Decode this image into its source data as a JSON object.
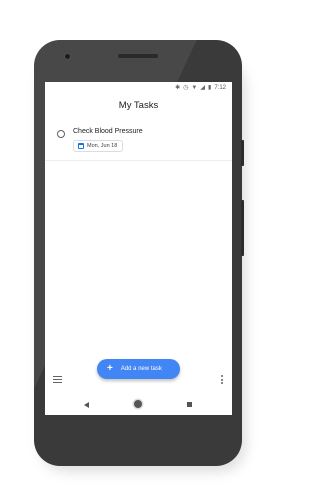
{
  "status_bar": {
    "time": "7:12",
    "icons": [
      "bluetooth-icon",
      "alarm-icon",
      "wifi-icon",
      "signal-icon",
      "battery-icon"
    ]
  },
  "app": {
    "title": "My Tasks"
  },
  "tasks": [
    {
      "title": "Check Blood Pressure",
      "due_date": "Mon, Jun 18",
      "completed": false
    }
  ],
  "fab": {
    "label": "Add a new task",
    "icon": "plus-icon"
  },
  "bottom_bar": {
    "left_icon": "menu-icon",
    "right_icon": "more-vert-icon"
  },
  "nav_bar": {
    "buttons": [
      "back-icon",
      "home-icon",
      "recents-icon"
    ]
  },
  "colors": {
    "accent": "#4285f4",
    "phone_body": "#3a3a3a",
    "text_primary": "#202124"
  }
}
